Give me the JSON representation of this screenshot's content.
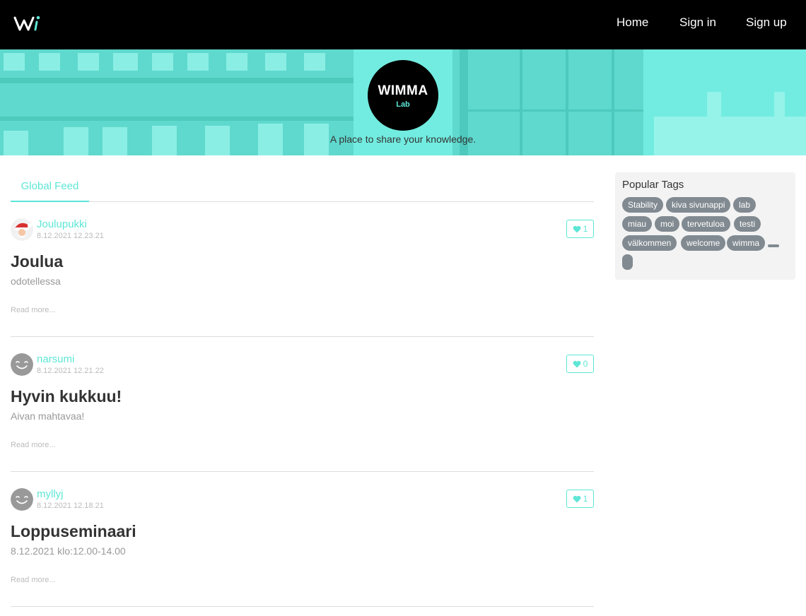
{
  "nav": {
    "brand": "Wi",
    "links": [
      "Home",
      "Sign in",
      "Sign up"
    ]
  },
  "banner": {
    "logo_text": "WIMMA",
    "logo_sub": "Lab",
    "tagline": "A place to share your knowledge."
  },
  "feed": {
    "tab": "Global Feed",
    "articles": [
      {
        "author": "Joulupukki",
        "date": "8.12.2021 12.23.21",
        "favorites": "1",
        "title": "Joulua",
        "description": "odotellessa",
        "read_more": "Read more..."
      },
      {
        "author": "narsumi",
        "date": "8.12.2021 12.21.22",
        "favorites": "0",
        "title": "Hyvin kukkuu!",
        "description": "Aivan mahtavaa!",
        "read_more": "Read more..."
      },
      {
        "author": "myllyj",
        "date": "8.12.2021 12.18.21",
        "favorites": "1",
        "title": "Loppuseminaari",
        "description": "8.12.2021 klo:12.00-14.00",
        "read_more": "Read more..."
      }
    ]
  },
  "sidebar": {
    "title": "Popular Tags",
    "tags": [
      "Stability",
      "kiva sivunappi",
      "lab",
      "miau",
      "moi",
      "tervetuloa",
      "testi",
      "välkommen",
      "welcome",
      "wimma"
    ]
  },
  "colors": {
    "accent": "#5ee6d6",
    "navbar": "#000000",
    "banner": "#72ece0",
    "tag": "#818a91"
  },
  "icons": [
    "heart-icon",
    "santa-avatar",
    "smiley-avatar"
  ]
}
